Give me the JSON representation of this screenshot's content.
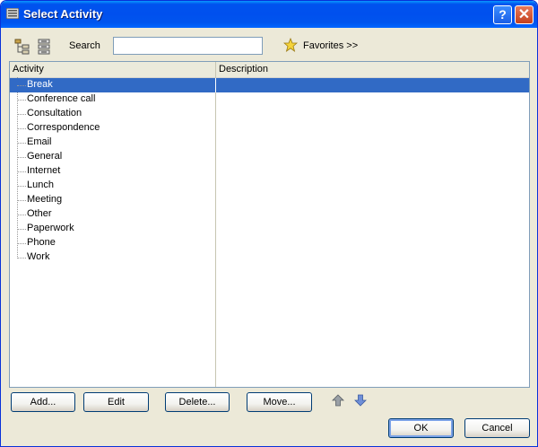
{
  "window": {
    "title": "Select Activity",
    "help_label": "?",
    "close_label": "✕"
  },
  "toolbar": {
    "search_label": "Search",
    "search_value": "",
    "favorites_label": "Favorites >>"
  },
  "columns": {
    "activity": "Activity",
    "description": "Description"
  },
  "activities": [
    {
      "name": "Break",
      "description": "",
      "selected": true
    },
    {
      "name": "Conference call",
      "description": ""
    },
    {
      "name": "Consultation",
      "description": ""
    },
    {
      "name": "Correspondence",
      "description": ""
    },
    {
      "name": "Email",
      "description": ""
    },
    {
      "name": "General",
      "description": ""
    },
    {
      "name": "Internet",
      "description": ""
    },
    {
      "name": "Lunch",
      "description": ""
    },
    {
      "name": "Meeting",
      "description": ""
    },
    {
      "name": "Other",
      "description": ""
    },
    {
      "name": "Paperwork",
      "description": ""
    },
    {
      "name": "Phone",
      "description": ""
    },
    {
      "name": "Work",
      "description": ""
    }
  ],
  "buttons": {
    "add": "Add...",
    "edit": "Edit",
    "delete": "Delete...",
    "move": "Move...",
    "ok": "OK",
    "cancel": "Cancel"
  },
  "colors": {
    "selection": "#316ac5",
    "titlebar": "#0053ee",
    "face": "#ece9d8"
  }
}
